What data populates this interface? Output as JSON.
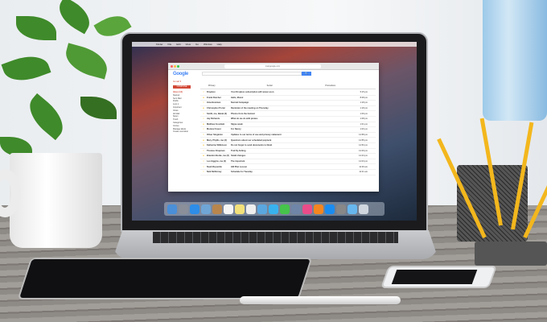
{
  "browser": {
    "url": "mail.google.com"
  },
  "menubar": {
    "items": [
      "Finder",
      "File",
      "Edit",
      "View",
      "Go",
      "Window",
      "Help"
    ]
  },
  "gmail": {
    "logo": "Google",
    "label": "Gmail ▾",
    "search_button": "🔍",
    "compose": "COMPOSE",
    "sidebar": [
      "Inbox (13)",
      "Starred",
      "Sent Mail",
      "Drafts",
      "Less ▾",
      "Important",
      "Chats",
      "All Mail",
      "Spam",
      "Trash",
      "Categories",
      "Circles",
      "Manage labels",
      "Create new label"
    ],
    "tabs": [
      "Primary",
      "Social",
      "Promotions"
    ],
    "emails": [
      {
        "from": "Dropbox",
        "subject": "Your Dropbox subscription will renew soon",
        "time": "5:15 pm",
        "starred": false
      },
      {
        "from": "Frank Fletcher",
        "subject": "Hello, Mona!",
        "time": "8:48 pm",
        "starred": true
      },
      {
        "from": "Gina Bowman",
        "subject": "Normal Campaign",
        "time": "1:18 pm",
        "starred": false
      },
      {
        "from": "Christopher Porter",
        "subject": "Reminder of the meeting on Thursday",
        "time": "1:18 pm",
        "starred": true
      },
      {
        "from": "Smith, me, Barak (3)",
        "subject": "Photos from the festival",
        "time": "1:09 pm",
        "starred": false
      },
      {
        "from": "Jay Richards",
        "subject": "What do we do with pirates",
        "time": "1:08 pm",
        "starred": false
      },
      {
        "from": "Matthew Goodwin",
        "subject": "Skype week",
        "time": "1:01 pm",
        "starred": true
      },
      {
        "from": "Monica Fraust",
        "subject": "For Nancy",
        "time": "1:00 pm",
        "starred": false
      },
      {
        "from": "Oliver Singleton",
        "subject": "Updates to our terms of use and privacy statement",
        "time": "12:58 pm",
        "starred": false
      },
      {
        "from": "Mary, Phyllis, me (3)",
        "subject": "Questions about our scheduled payment",
        "time": "12:55 pm",
        "starred": true
      },
      {
        "from": "Katherine Wilkinson",
        "subject": "Do not forget to send documents to Noah",
        "time": "12:50 pm",
        "starred": true
      },
      {
        "from": "Thomas Chapman",
        "subject": "Trail fly-fishing",
        "time": "12:49 pm",
        "starred": false
      },
      {
        "from": "Brandon Burke, me (2)",
        "subject": "Small changes",
        "time": "12:23 pm",
        "starred": true
      },
      {
        "from": "Leo Higgins, me (2)",
        "subject": "The important",
        "time": "12:03 pm",
        "starred": false
      },
      {
        "from": "Noah Reynolds",
        "subject": "Hill Plan Lesson",
        "time": "11:39 am",
        "starred": false
      },
      {
        "from": "Nick McKinney",
        "subject": "Schedule for Tuesday",
        "time": "11:21 am",
        "starred": false
      }
    ]
  },
  "dock_colors": [
    "#4a8fd8",
    "#8a8f99",
    "#2d8de8",
    "#6fa6d6",
    "#b8864d",
    "#f5f5f5",
    "#f2e17a",
    "#eeeeee",
    "#5aa7e0",
    "#38b2ef",
    "#46c34a",
    "#6f86a8",
    "#ea4c89",
    "#f5861f",
    "#1a8cf0",
    "#888",
    "#67b7ee",
    "#cfd6de"
  ]
}
